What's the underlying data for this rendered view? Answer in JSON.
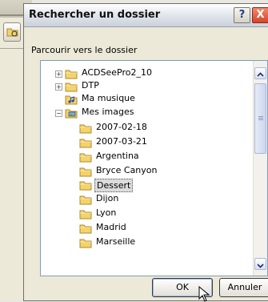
{
  "dialog": {
    "title": "Rechercher un dossier",
    "help_label": "?",
    "close_label": "X",
    "prompt": "Parcourir vers le dossier"
  },
  "tree": {
    "items": [
      {
        "label": "ACDSeePro2_10",
        "expander": "+",
        "icon": "folder-icon"
      },
      {
        "label": "DTP",
        "expander": "+",
        "icon": "folder-icon"
      },
      {
        "label": "Ma musique",
        "expander": "",
        "icon": "music-folder-icon"
      },
      {
        "label": "Mes images",
        "expander": "−",
        "icon": "pictures-folder-icon"
      },
      {
        "label": "2007-02-18",
        "expander": "",
        "icon": "folder-icon"
      },
      {
        "label": "2007-03-21",
        "expander": "",
        "icon": "folder-icon"
      },
      {
        "label": "Argentina",
        "expander": "",
        "icon": "folder-icon"
      },
      {
        "label": "Bryce Canyon",
        "expander": "",
        "icon": "folder-icon"
      },
      {
        "label": "Dessert",
        "expander": "",
        "icon": "folder-icon",
        "selected": true
      },
      {
        "label": "Dijon",
        "expander": "",
        "icon": "folder-icon"
      },
      {
        "label": "Lyon",
        "expander": "",
        "icon": "folder-icon"
      },
      {
        "label": "Madrid",
        "expander": "",
        "icon": "folder-icon"
      },
      {
        "label": "Marseille",
        "expander": "",
        "icon": "folder-icon"
      }
    ]
  },
  "buttons": {
    "ok": "OK",
    "cancel": "Annuler"
  }
}
